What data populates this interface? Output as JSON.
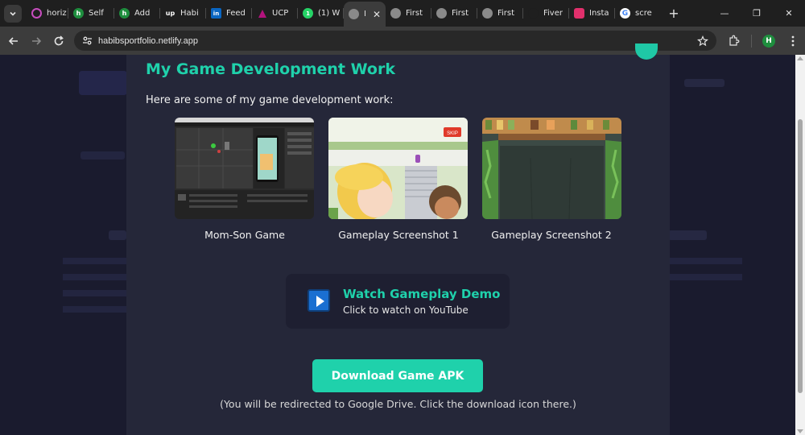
{
  "browser": {
    "tabs": [
      {
        "label": "horiz",
        "icon": "ring-icon",
        "color": "#c74dbe"
      },
      {
        "label": "Self",
        "icon": "h-logo-icon",
        "color": "#1e8e3e"
      },
      {
        "label": "Add",
        "icon": "h-logo-icon",
        "color": "#1e8e3e"
      },
      {
        "label": "Habi",
        "icon": "upwork-icon",
        "color": "#3a3a3a"
      },
      {
        "label": "Feed",
        "icon": "linkedin-icon",
        "color": "#0a66c2"
      },
      {
        "label": "UCP",
        "icon": "ucp-icon",
        "color": "#b3127d"
      },
      {
        "label": "(1) W",
        "icon": "whatsapp-icon",
        "color": "#25d366"
      },
      {
        "label": "I",
        "icon": "globe-icon",
        "color": "#8a8a8a",
        "active": true
      },
      {
        "label": "First",
        "icon": "globe-icon",
        "color": "#8a8a8a"
      },
      {
        "label": "First",
        "icon": "globe-icon",
        "color": "#8a8a8a"
      },
      {
        "label": "First",
        "icon": "globe-icon",
        "color": "#8a8a8a"
      },
      {
        "label": "Fiver",
        "icon": "fiverr-icon",
        "color": "#1f1f1f"
      },
      {
        "label": "Insta",
        "icon": "instagram-icon",
        "color": "#e1306c"
      },
      {
        "label": "scre",
        "icon": "google-icon",
        "color": "#ffffff"
      }
    ],
    "url": "habibsportfolio.netlify.app",
    "profile_initial": "H"
  },
  "modal": {
    "title": "My Game Development Work",
    "intro": "Here are some of my game development work:",
    "screenshots": [
      {
        "caption": "Mom-Son Game"
      },
      {
        "caption": "Gameplay Screenshot 1",
        "badge": "SKIP"
      },
      {
        "caption": "Gameplay Screenshot 2"
      }
    ],
    "watch": {
      "title": "Watch Gameplay Demo",
      "subtitle": "Click to watch on YouTube"
    },
    "download_label": "Download Game APK",
    "download_note": "(You will be redirected to Google Drive. Click the download icon there.)"
  },
  "colors": {
    "accent": "#1fd1ab",
    "modal_bg": "#252739",
    "page_bg": "#1a1b2e"
  }
}
